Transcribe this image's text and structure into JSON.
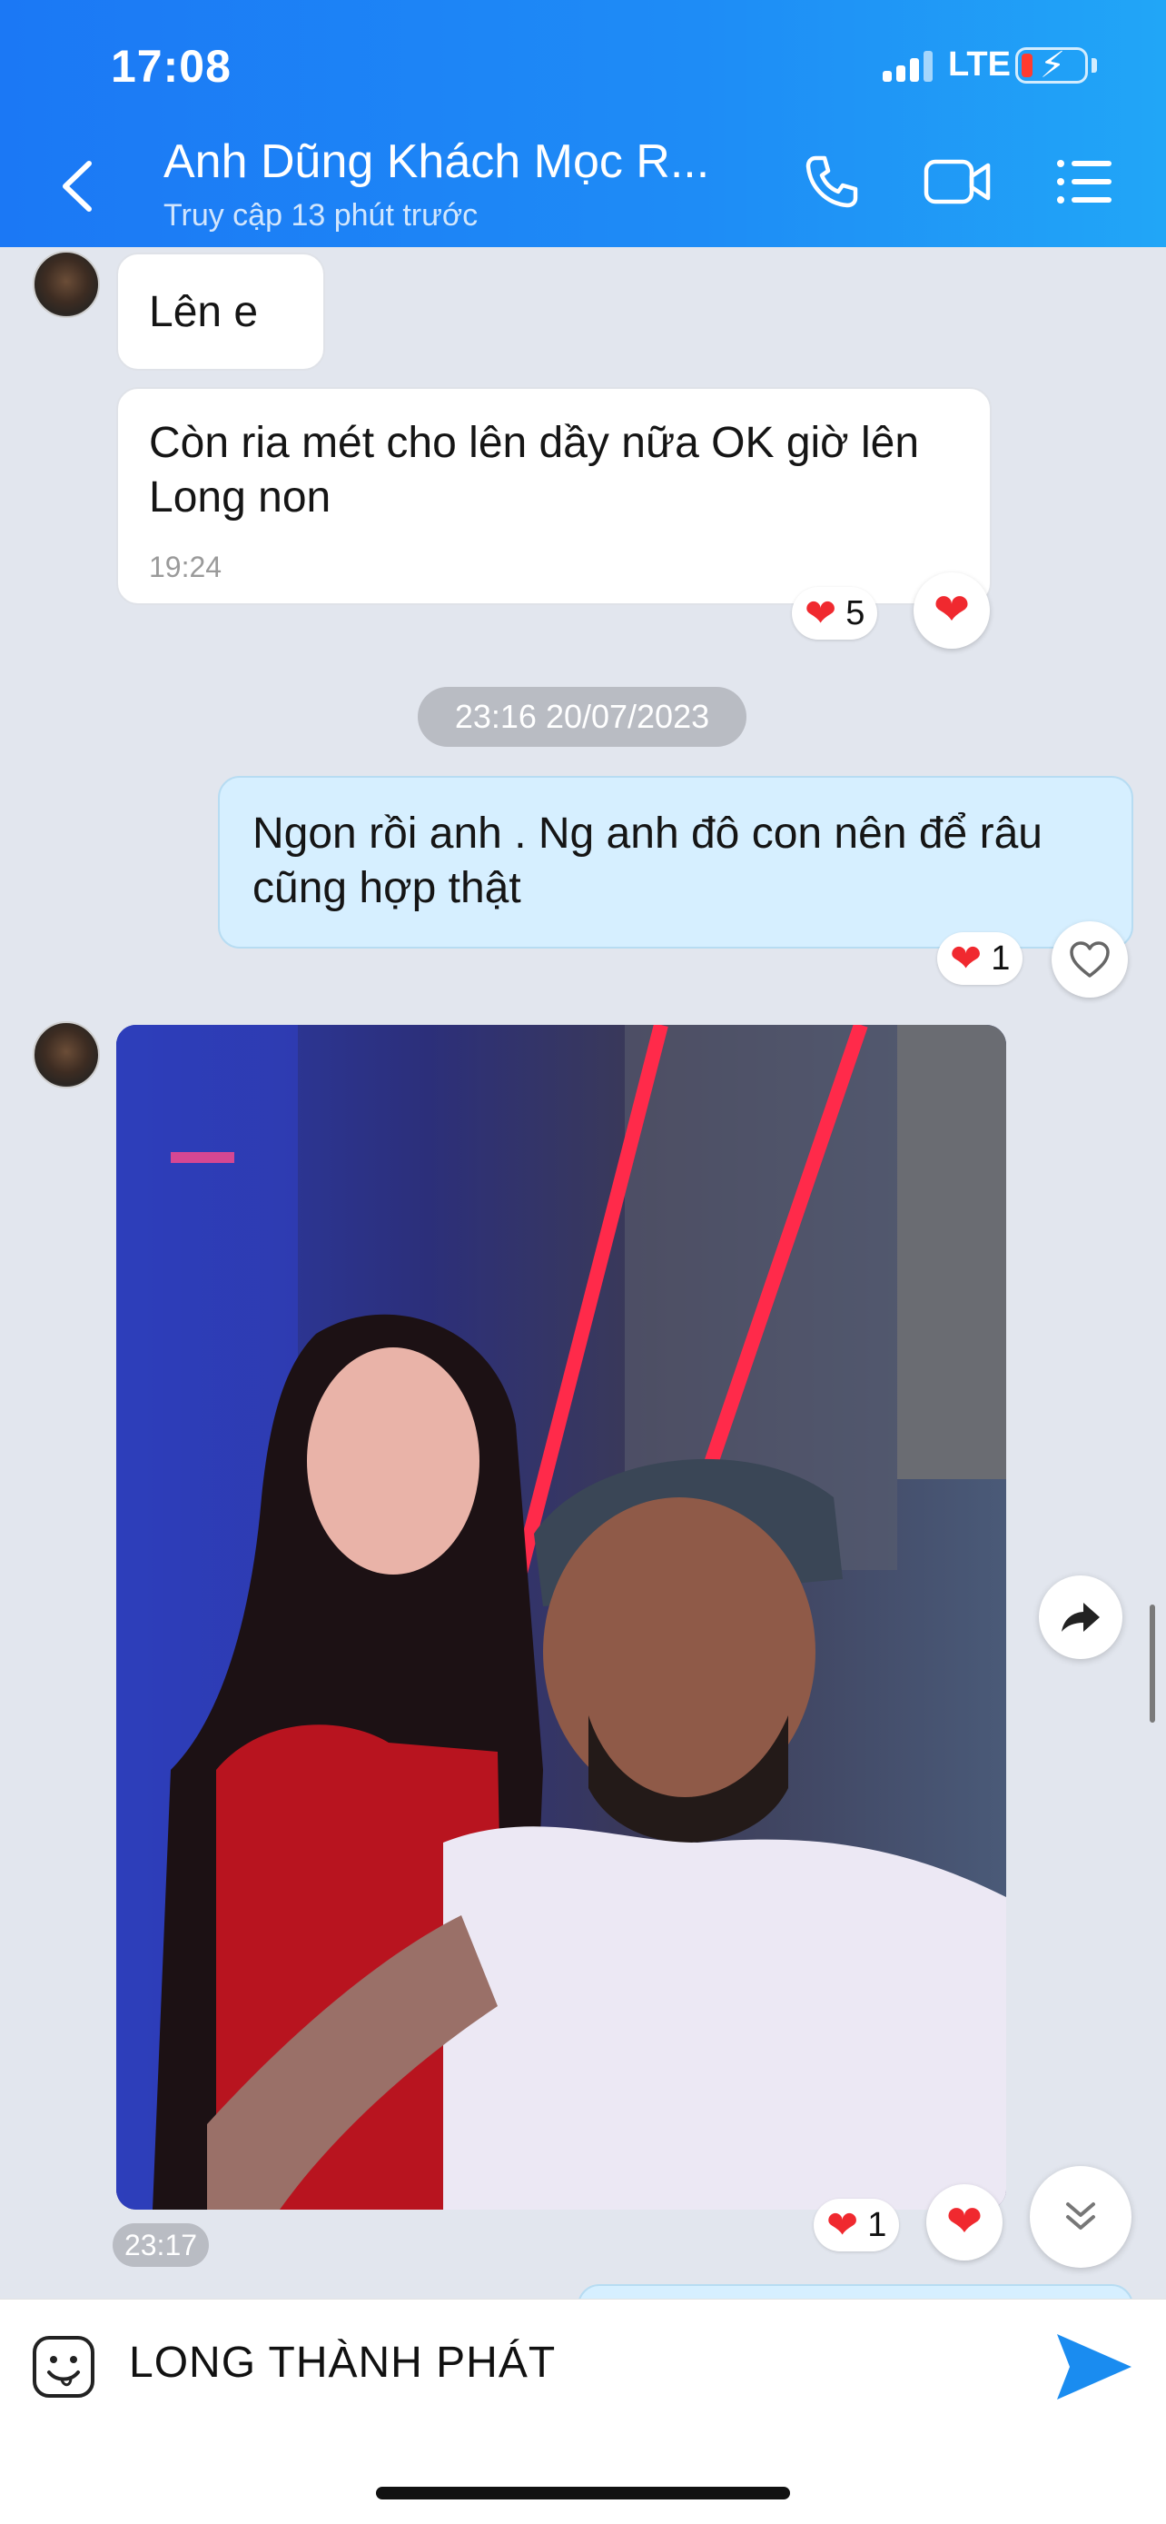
{
  "status_bar": {
    "time": "17:08",
    "network": "LTE"
  },
  "header": {
    "title": "Anh Dũng Khách Mọc R...",
    "subtitle": "Truy cập 13 phút trước"
  },
  "messages": [
    {
      "text": "Lên e"
    },
    {
      "text_line1": "Còn ria mét cho lên dầy nữa OK giờ lên",
      "text_line2": "Long non",
      "time": "19:24",
      "reaction_count": "5"
    },
    {
      "text_line1": "Ngon rồi anh . Ng anh đô con nên để râu",
      "text_line2": "cũng hợp thật",
      "reaction_count": "1"
    }
  ],
  "date_separator": "23:16 20/07/2023",
  "photo_message": {
    "time": "23:17",
    "reaction_count": "1"
  },
  "input": {
    "value": "LONG THÀNH PHÁT"
  },
  "colors": {
    "header_accent": "#1e8cf6",
    "my_bubble": "#d6efff",
    "heart": "#f0292f",
    "send": "#1a8cf0"
  }
}
